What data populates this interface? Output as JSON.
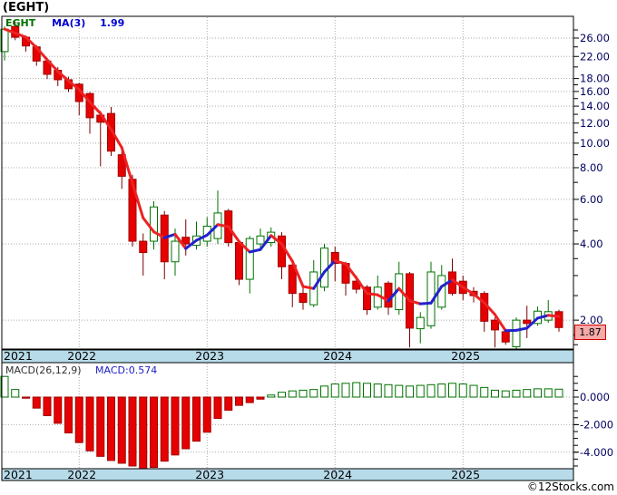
{
  "title": "(EGHT)",
  "legend": {
    "symbol": "EGHT",
    "ma_label": "MA(3)",
    "ma_value": "1.99"
  },
  "price_badge": "1.87",
  "watermark": "©12Stocks.com",
  "macd_header": {
    "label": "MACD(26,12,9)",
    "value": "MACD:0.574"
  },
  "years": {
    "labels": [
      "2021",
      "2022",
      "2023",
      "2024",
      "2025"
    ],
    "jan_indices": [
      null,
      7,
      19,
      31,
      43
    ]
  },
  "price_axis": {
    "major": [
      [
        26,
        "26.00"
      ],
      [
        22,
        "22.00"
      ],
      [
        18,
        "18.00"
      ],
      [
        16,
        "16.00"
      ],
      [
        14,
        "14.00"
      ],
      [
        12,
        "12.00"
      ],
      [
        10,
        "10.00"
      ],
      [
        8,
        "8.00"
      ],
      [
        6,
        "6.00"
      ],
      [
        4,
        "4.00"
      ],
      [
        2,
        "2.00"
      ]
    ],
    "minor": [
      28,
      24,
      20,
      17,
      15,
      13,
      11,
      9,
      7,
      5,
      4.5,
      3.5,
      3,
      2.5,
      1.75,
      1.6
    ]
  },
  "macd_axis": {
    "major": [
      [
        0,
        "0.000"
      ],
      [
        -2,
        "-2.000"
      ],
      [
        -4,
        "-4.000"
      ]
    ],
    "minor_from": -5.0,
    "minor_to": 1.5,
    "minor_step": 0.5
  },
  "colors": {
    "candle_up_stroke": "#007200",
    "candle_up_fill": "#FFFFFF",
    "candle_down_fill": "#E60000",
    "candle_down_stroke": "#A00000",
    "wick_down": "#7B0000",
    "ma_up": "#2222CC",
    "ma_down": "#EE2222",
    "grid": "#AAAAAA",
    "border": "#000000",
    "band_bg": "#B7DBE9",
    "axis_text": "#000060",
    "year_text": "#000000"
  },
  "chart_data": [
    {
      "type": "candlestick",
      "title": "EGHT monthly price with MA(3) overlay",
      "yscale": "log",
      "ylim": [
        1.5,
        31.5
      ],
      "legend": [
        "EGHT",
        "MA(3)"
      ],
      "last_close": 1.87,
      "ma_final": 1.99,
      "x_dates": [
        "2021-06",
        "2021-07",
        "2021-08",
        "2021-09",
        "2021-10",
        "2021-11",
        "2021-12",
        "2022-01",
        "2022-02",
        "2022-03",
        "2022-04",
        "2022-05",
        "2022-06",
        "2022-07",
        "2022-08",
        "2022-09",
        "2022-10",
        "2022-11",
        "2022-12",
        "2023-01",
        "2023-02",
        "2023-03",
        "2023-04",
        "2023-05",
        "2023-06",
        "2023-07",
        "2023-08",
        "2023-09",
        "2023-10",
        "2023-11",
        "2023-12",
        "2024-01",
        "2024-02",
        "2024-03",
        "2024-04",
        "2024-05",
        "2024-06",
        "2024-07",
        "2024-08",
        "2024-09",
        "2024-10",
        "2024-11",
        "2024-12",
        "2025-01",
        "2025-02",
        "2025-03",
        "2025-04",
        "2025-05",
        "2025-06",
        "2025-07",
        "2025-08",
        "2025-09",
        "2025-10"
      ],
      "ohlc": [
        [
          23.0,
          28.9,
          21.2,
          28.2
        ],
        [
          28.9,
          30.2,
          25.5,
          26.2
        ],
        [
          26.2,
          26.6,
          23.0,
          24.2
        ],
        [
          24.0,
          24.4,
          20.2,
          21.1
        ],
        [
          21.1,
          21.7,
          17.9,
          18.7
        ],
        [
          19.4,
          20.0,
          16.8,
          17.8
        ],
        [
          17.8,
          18.3,
          15.9,
          16.4
        ],
        [
          17.1,
          17.3,
          12.9,
          14.6
        ],
        [
          15.7,
          15.9,
          10.9,
          12.6
        ],
        [
          12.9,
          13.4,
          8.1,
          12.1
        ],
        [
          13.1,
          13.9,
          8.9,
          9.3
        ],
        [
          9.0,
          9.3,
          6.6,
          7.4
        ],
        [
          7.2,
          7.5,
          3.9,
          4.1
        ],
        [
          4.1,
          4.4,
          3.0,
          3.7
        ],
        [
          4.1,
          5.9,
          3.8,
          5.6
        ],
        [
          5.2,
          5.4,
          2.9,
          3.4
        ],
        [
          3.4,
          4.6,
          3.0,
          4.1
        ],
        [
          4.25,
          5.0,
          3.6,
          4.0
        ],
        [
          3.95,
          4.9,
          3.8,
          4.3
        ],
        [
          4.1,
          5.1,
          3.9,
          4.7
        ],
        [
          4.2,
          6.5,
          4.0,
          5.3
        ],
        [
          5.4,
          5.5,
          3.9,
          4.05
        ],
        [
          4.05,
          4.15,
          2.75,
          2.9
        ],
        [
          2.9,
          4.3,
          2.55,
          4.2
        ],
        [
          4.0,
          4.6,
          3.8,
          4.3
        ],
        [
          4.05,
          4.65,
          3.9,
          4.45
        ],
        [
          4.3,
          4.45,
          2.9,
          3.25
        ],
        [
          3.3,
          3.4,
          2.25,
          2.55
        ],
        [
          2.55,
          2.7,
          2.2,
          2.35
        ],
        [
          2.3,
          3.45,
          2.25,
          3.1
        ],
        [
          2.7,
          4.0,
          2.6,
          3.85
        ],
        [
          3.7,
          3.9,
          2.85,
          3.35
        ],
        [
          3.35,
          3.4,
          2.5,
          2.8
        ],
        [
          2.85,
          3.0,
          2.55,
          2.65
        ],
        [
          2.7,
          2.75,
          2.1,
          2.2
        ],
        [
          2.25,
          3.0,
          2.2,
          2.7
        ],
        [
          2.8,
          2.85,
          2.1,
          2.25
        ],
        [
          2.2,
          3.4,
          2.1,
          3.05
        ],
        [
          3.05,
          3.1,
          1.56,
          1.86
        ],
        [
          1.85,
          2.15,
          1.62,
          2.05
        ],
        [
          1.9,
          3.4,
          1.85,
          3.1
        ],
        [
          2.25,
          3.3,
          2.2,
          3.0
        ],
        [
          3.1,
          3.5,
          2.5,
          2.55
        ],
        [
          2.85,
          3.0,
          2.4,
          2.55
        ],
        [
          2.6,
          2.7,
          2.35,
          2.5
        ],
        [
          2.55,
          2.6,
          1.8,
          1.98
        ],
        [
          2.0,
          2.05,
          1.56,
          1.83
        ],
        [
          1.8,
          1.85,
          1.6,
          1.64
        ],
        [
          1.57,
          2.05,
          1.53,
          2.0
        ],
        [
          2.0,
          2.28,
          1.7,
          1.94
        ],
        [
          1.94,
          2.26,
          1.9,
          2.17
        ],
        [
          2.0,
          2.4,
          1.95,
          2.16
        ],
        [
          2.16,
          2.2,
          1.8,
          1.87
        ]
      ]
    },
    {
      "type": "bar",
      "title": "MACD(26,12,9)",
      "x": "same months as chart_data[0].x_dates",
      "ylim": [
        -5.5,
        2.2
      ],
      "final": 0.574,
      "values": [
        1.5,
        0.55,
        -0.08,
        -0.8,
        -1.35,
        -1.9,
        -2.6,
        -3.3,
        -3.9,
        -4.3,
        -4.6,
        -4.8,
        -5.0,
        -5.2,
        -5.1,
        -4.65,
        -4.2,
        -3.75,
        -3.2,
        -2.55,
        -1.55,
        -0.95,
        -0.6,
        -0.4,
        -0.15,
        0.15,
        0.35,
        0.45,
        0.5,
        0.55,
        0.8,
        0.95,
        1.0,
        1.05,
        1.0,
        0.95,
        0.9,
        0.85,
        0.8,
        0.85,
        0.9,
        0.95,
        1.0,
        0.95,
        0.85,
        0.7,
        0.5,
        0.45,
        0.5,
        0.55,
        0.6,
        0.6,
        0.574
      ]
    }
  ]
}
